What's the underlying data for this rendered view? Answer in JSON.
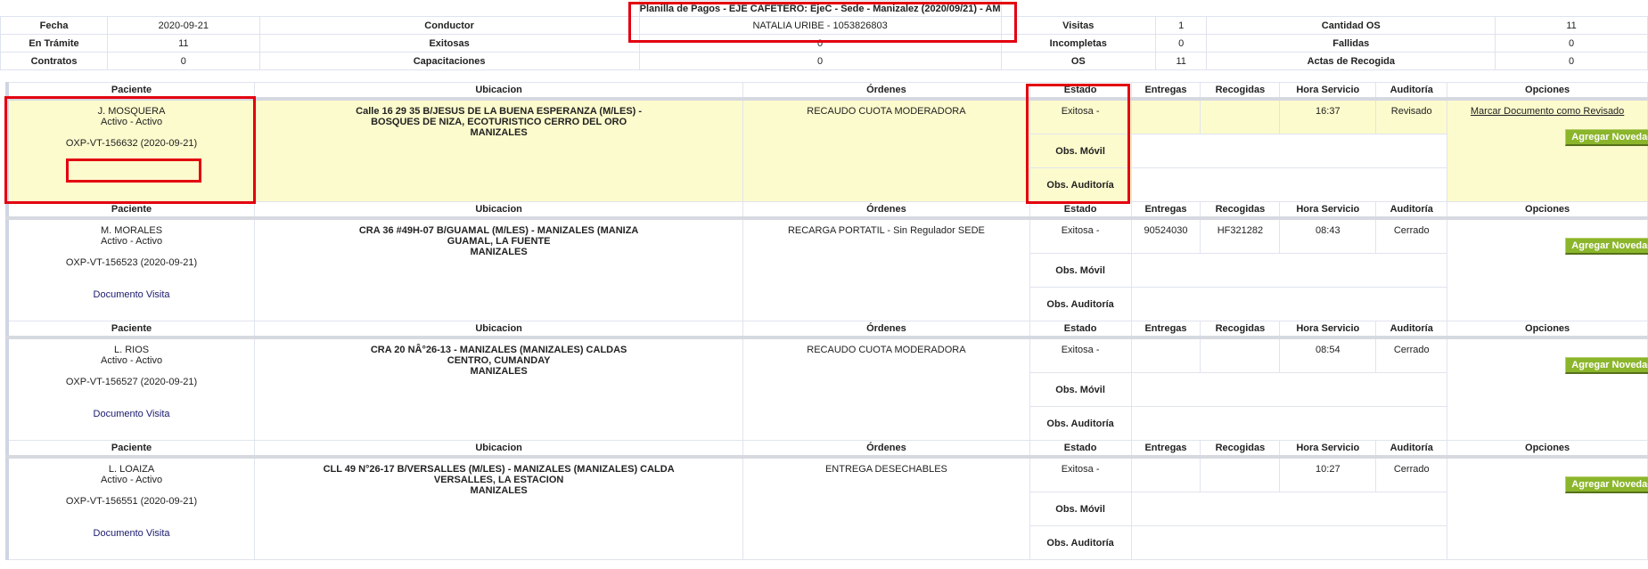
{
  "header": {
    "title": "Planilla de Pagos - EJE CAFETERO: EjeC - Sede - Manizalez (2020/09/21) - AM",
    "conductor_value": "NATALIA URIBE - 1053826803"
  },
  "summary": {
    "fecha_label": "Fecha",
    "fecha_value": "2020-09-21",
    "conductor_label": "Conductor",
    "visitas_label": "Visitas",
    "visitas_value": "1",
    "cantidad_os_label": "Cantidad OS",
    "cantidad_os_value": "11",
    "en_tramite_label": "En Trámite",
    "en_tramite_value": "11",
    "exitosas_label": "Exitosas",
    "exitosas_value": "0",
    "incompletas_label": "Incompletas",
    "incompletas_value": "0",
    "fallidas_label": "Fallidas",
    "fallidas_value": "0",
    "contratos_label": "Contratos",
    "contratos_value": "0",
    "capacitaciones_label": "Capacitaciones",
    "capacitaciones_value": "0",
    "os_label": "OS",
    "os_value": "11",
    "actas_label": "Actas de Recogida",
    "actas_value": "0"
  },
  "columns": {
    "paciente": "Paciente",
    "ubicacion": "Ubicacion",
    "ordenes": "Órdenes",
    "estado": "Estado",
    "entregas": "Entregas",
    "recogidas": "Recogidas",
    "hora": "Hora Servicio",
    "auditoria": "Auditoría",
    "opciones": "Opciones"
  },
  "labels": {
    "obs_movil": "Obs. Móvil",
    "obs_auditoria": "Obs. Auditoría",
    "agregar": "Agregar Novedad",
    "documento_visita": "Documento Visita",
    "marcar": "Marcar Documento como Revisado"
  },
  "records": [
    {
      "name": "J. MOSQUERA",
      "status": "Activo - Activo",
      "code": "OXP-VT-156632 (2020-09-21)",
      "addr1": "Calle 16 29 35 B/JESUS DE LA BUENA ESPERANZA (M/LES) -",
      "addr2": "BOSQUES DE NIZA, ECOTURISTICO CERRO DEL ORO",
      "addr3": "MANIZALES",
      "orden": "RECAUDO CUOTA MODERADORA",
      "estado": "Exitosa -",
      "entregas": "",
      "recogidas": "",
      "hora": "16:37",
      "auditoria": "Revisado"
    },
    {
      "name": "M. MORALES",
      "status": "Activo - Activo",
      "code": "OXP-VT-156523 (2020-09-21)",
      "addr1": "CRA 36 #49H-07 B/GUAMAL (M/LES) - MANIZALES (MANIZA",
      "addr2": "GUAMAL, LA FUENTE",
      "addr3": "MANIZALES",
      "orden": "RECARGA PORTATIL - Sin Regulador SEDE",
      "estado": "Exitosa -",
      "entregas": "90524030",
      "recogidas": "HF321282",
      "hora": "08:43",
      "auditoria": "Cerrado"
    },
    {
      "name": "L. RIOS",
      "status": "Activo - Activo",
      "code": "OXP-VT-156527 (2020-09-21)",
      "addr1": "CRA 20 NÂ°26-13 - MANIZALES (MANIZALES) CALDAS",
      "addr2": "CENTRO, CUMANDAY",
      "addr3": "MANIZALES",
      "orden": "RECAUDO CUOTA MODERADORA",
      "estado": "Exitosa -",
      "entregas": "",
      "recogidas": "",
      "hora": "08:54",
      "auditoria": "Cerrado"
    },
    {
      "name": "L. LOAIZA",
      "status": "Activo - Activo",
      "code": "OXP-VT-156551 (2020-09-21)",
      "addr1": "CLL 49 N°26-17 B/VERSALLES (M/LES) - MANIZALES (MANIZALES) CALDA",
      "addr2": "VERSALLES, LA ESTACION",
      "addr3": "MANIZALES",
      "orden": "ENTREGA DESECHABLES",
      "estado": "Exitosa -",
      "entregas": "",
      "recogidas": "",
      "hora": "10:27",
      "auditoria": "Cerrado"
    }
  ],
  "colors": {
    "highlight": "#fcfbcd",
    "button": "#8bb52b",
    "annotation": "#e3000f"
  }
}
